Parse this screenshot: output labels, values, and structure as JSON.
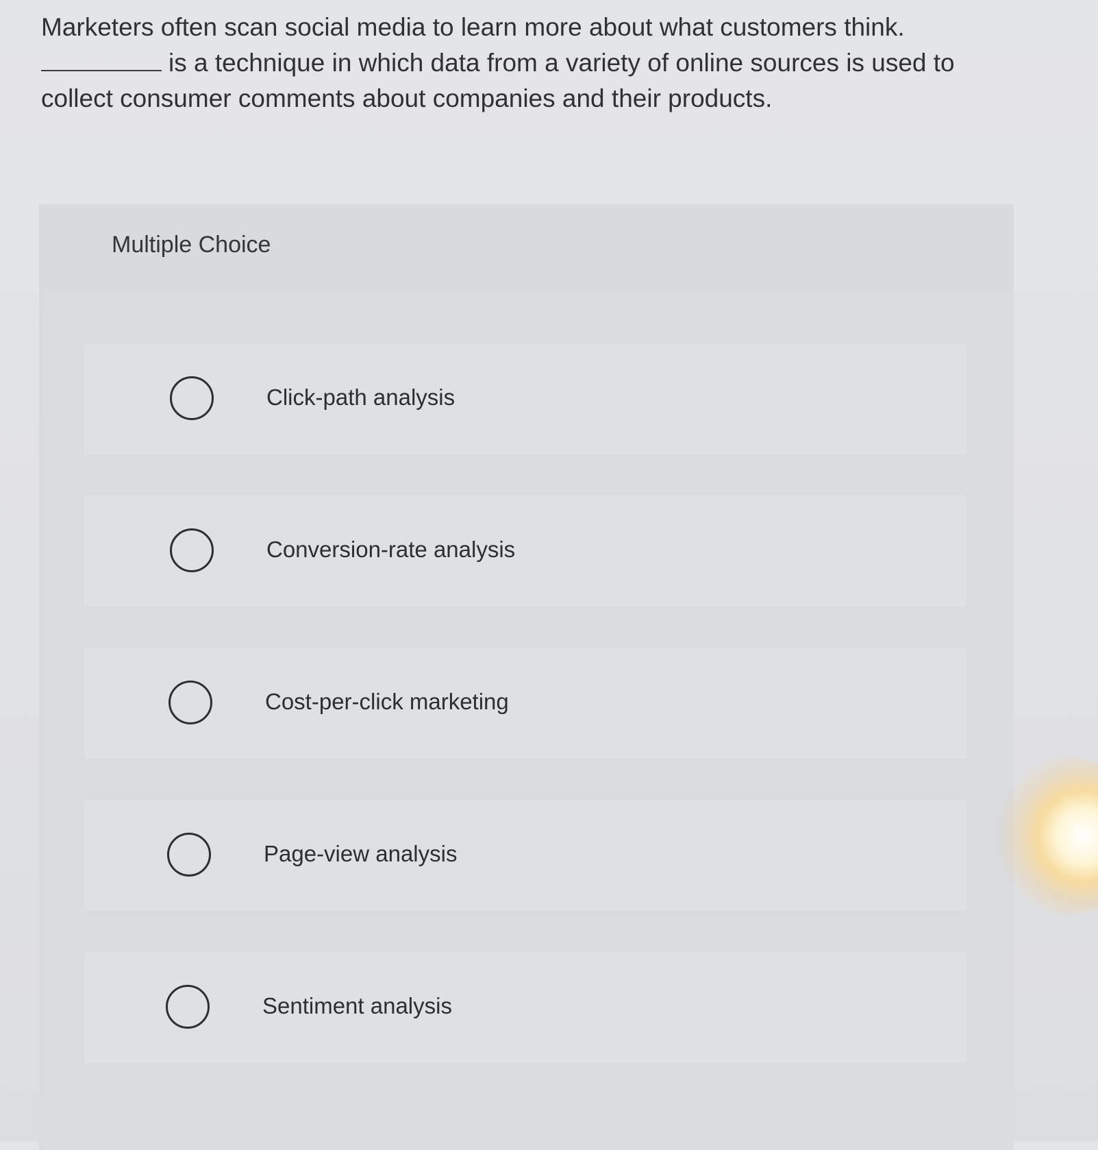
{
  "question": {
    "line1": "Marketers often scan social media to learn more about what customers think.",
    "line2": "is a technique in which data from a variety of online sources is used to collect consumer comments about companies and their products."
  },
  "panel": {
    "title": "Multiple Choice"
  },
  "options": [
    {
      "label": "Click-path analysis"
    },
    {
      "label": "Conversion-rate analysis"
    },
    {
      "label": "Cost-per-click marketing"
    },
    {
      "label": "Page-view analysis"
    },
    {
      "label": "Sentiment analysis"
    }
  ]
}
